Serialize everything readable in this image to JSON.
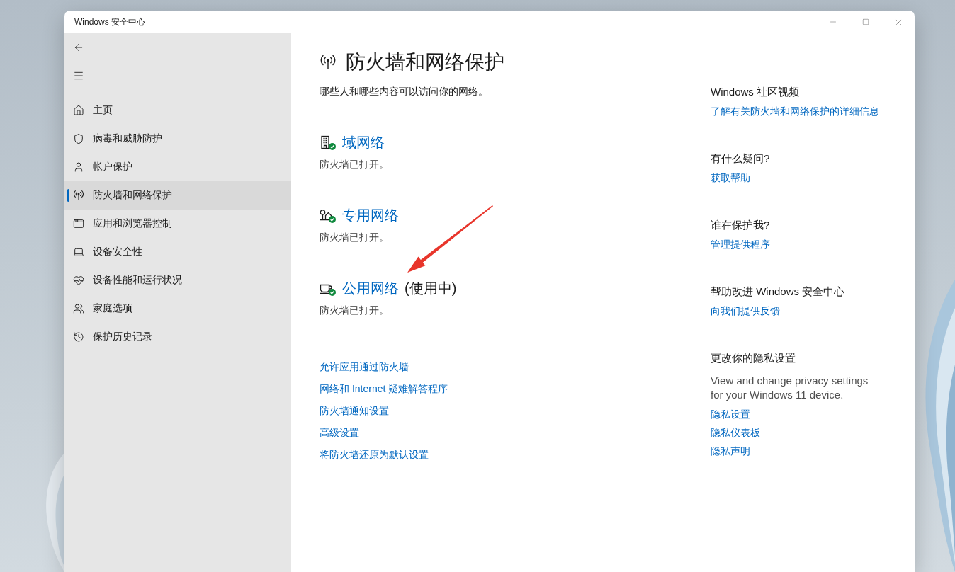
{
  "window": {
    "title": "Windows 安全中心"
  },
  "sidebar": {
    "items": [
      {
        "label": "主页",
        "selected": false
      },
      {
        "label": "病毒和威胁防护",
        "selected": false
      },
      {
        "label": "帐户保护",
        "selected": false
      },
      {
        "label": "防火墙和网络保护",
        "selected": true
      },
      {
        "label": "应用和浏览器控制",
        "selected": false
      },
      {
        "label": "设备安全性",
        "selected": false
      },
      {
        "label": "设备性能和运行状况",
        "selected": false
      },
      {
        "label": "家庭选项",
        "selected": false
      },
      {
        "label": "保护历史记录",
        "selected": false
      }
    ]
  },
  "page": {
    "title": "防火墙和网络保护",
    "subtitle": "哪些人和哪些内容可以访问你的网络。"
  },
  "networks": [
    {
      "name": "域网络",
      "status": "防火墙已打开。",
      "firewall_on": true
    },
    {
      "name": "专用网络",
      "status": "防火墙已打开。",
      "firewall_on": true
    },
    {
      "name": "公用网络",
      "tag": "(使用中)",
      "status": "防火墙已打开。",
      "firewall_on": true
    }
  ],
  "links": [
    "允许应用通过防火墙",
    "网络和 Internet 疑难解答程序",
    "防火墙通知设置",
    "高级设置",
    "将防火墙还原为默认设置"
  ],
  "side_panel": {
    "sections": [
      {
        "heading": "Windows 社区视频",
        "links": [
          "了解有关防火墙和网络保护的详细信息"
        ]
      },
      {
        "heading": "有什么疑问?",
        "links": [
          "获取帮助"
        ]
      },
      {
        "heading": "谁在保护我?",
        "links": [
          "管理提供程序"
        ]
      },
      {
        "heading": "帮助改进 Windows 安全中心",
        "links": [
          "向我们提供反馈"
        ]
      },
      {
        "heading": "更改你的隐私设置",
        "text": "View and change privacy settings for your Windows 11 device.",
        "links": [
          "隐私设置",
          "隐私仪表板",
          "隐私声明"
        ]
      }
    ]
  }
}
